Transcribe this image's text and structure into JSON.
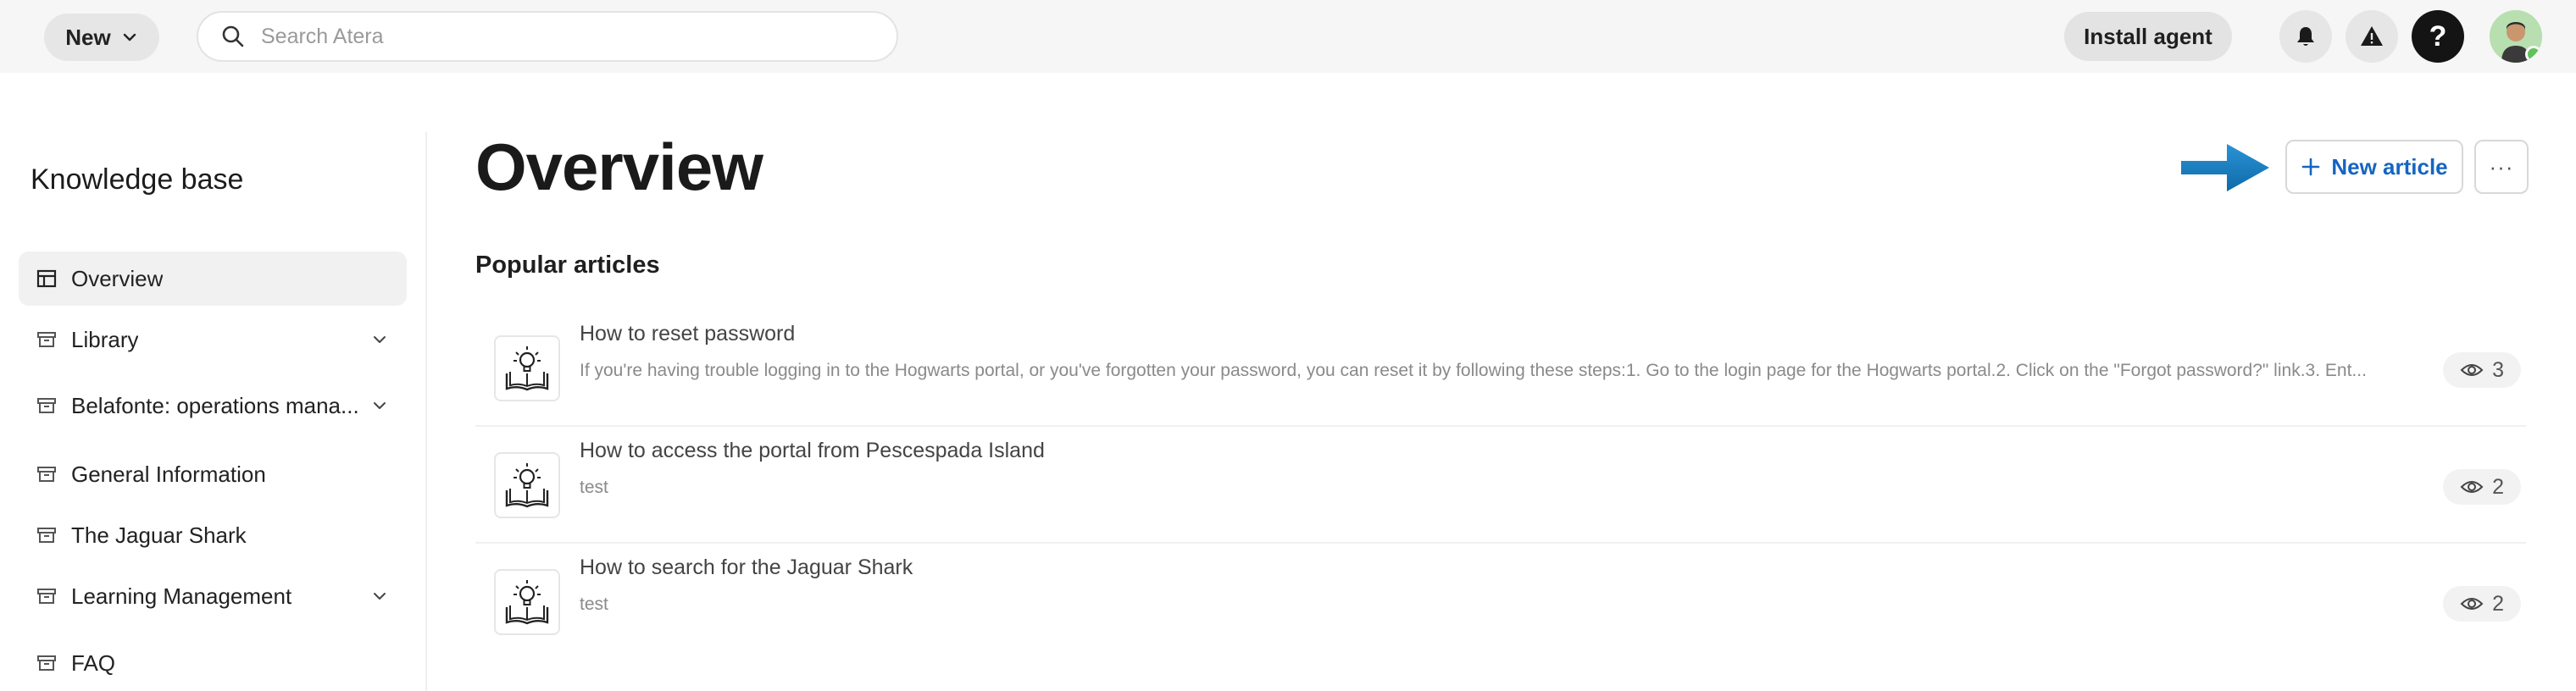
{
  "topbar": {
    "new_label": "New",
    "search_placeholder": "Search Atera",
    "install_agent_label": "Install agent",
    "help_glyph": "?"
  },
  "icons": {
    "new_chevron": "chevron-down-icon",
    "search": "search-icon",
    "notifications": "bell-icon",
    "alerts": "warning-icon",
    "help": "help-icon",
    "new_article_plus": "plus-icon",
    "views": "eye-icon",
    "article_thumb": "book-lightbulb-icon"
  },
  "sidebar": {
    "title": "Knowledge base",
    "items": [
      {
        "label": "Overview",
        "active": true,
        "expandable": false
      },
      {
        "label": "Library",
        "active": false,
        "expandable": true
      },
      {
        "label": "Belafonte: operations mana...",
        "active": false,
        "expandable": true
      },
      {
        "label": "General Information",
        "active": false,
        "expandable": false
      },
      {
        "label": "The Jaguar Shark",
        "active": false,
        "expandable": false
      },
      {
        "label": "Learning Management",
        "active": false,
        "expandable": true
      },
      {
        "label": "FAQ",
        "active": false,
        "expandable": false
      }
    ]
  },
  "main": {
    "title": "Overview",
    "new_article_label": "New article",
    "more_label": "···",
    "popular_title": "Popular articles",
    "articles": [
      {
        "title": "How to reset password",
        "body": "If you're having trouble logging in to the Hogwarts portal, or you've forgotten your password, you can reset it by following these steps:1. Go to the login page for the Hogwarts portal.2. Click on the \"Forgot password?\" link.3. Ent...",
        "views": "3"
      },
      {
        "title": "How to access the portal from Pescespada Island",
        "body": "test",
        "views": "2"
      },
      {
        "title": "How to search for the Jaguar Shark",
        "body": "test",
        "views": "2"
      }
    ]
  },
  "colors": {
    "accent_blue": "#1565c0",
    "arrow_blue": "#1b7fc4",
    "topbar_bg": "#f6f6f6",
    "status_online": "#5fc15c"
  }
}
